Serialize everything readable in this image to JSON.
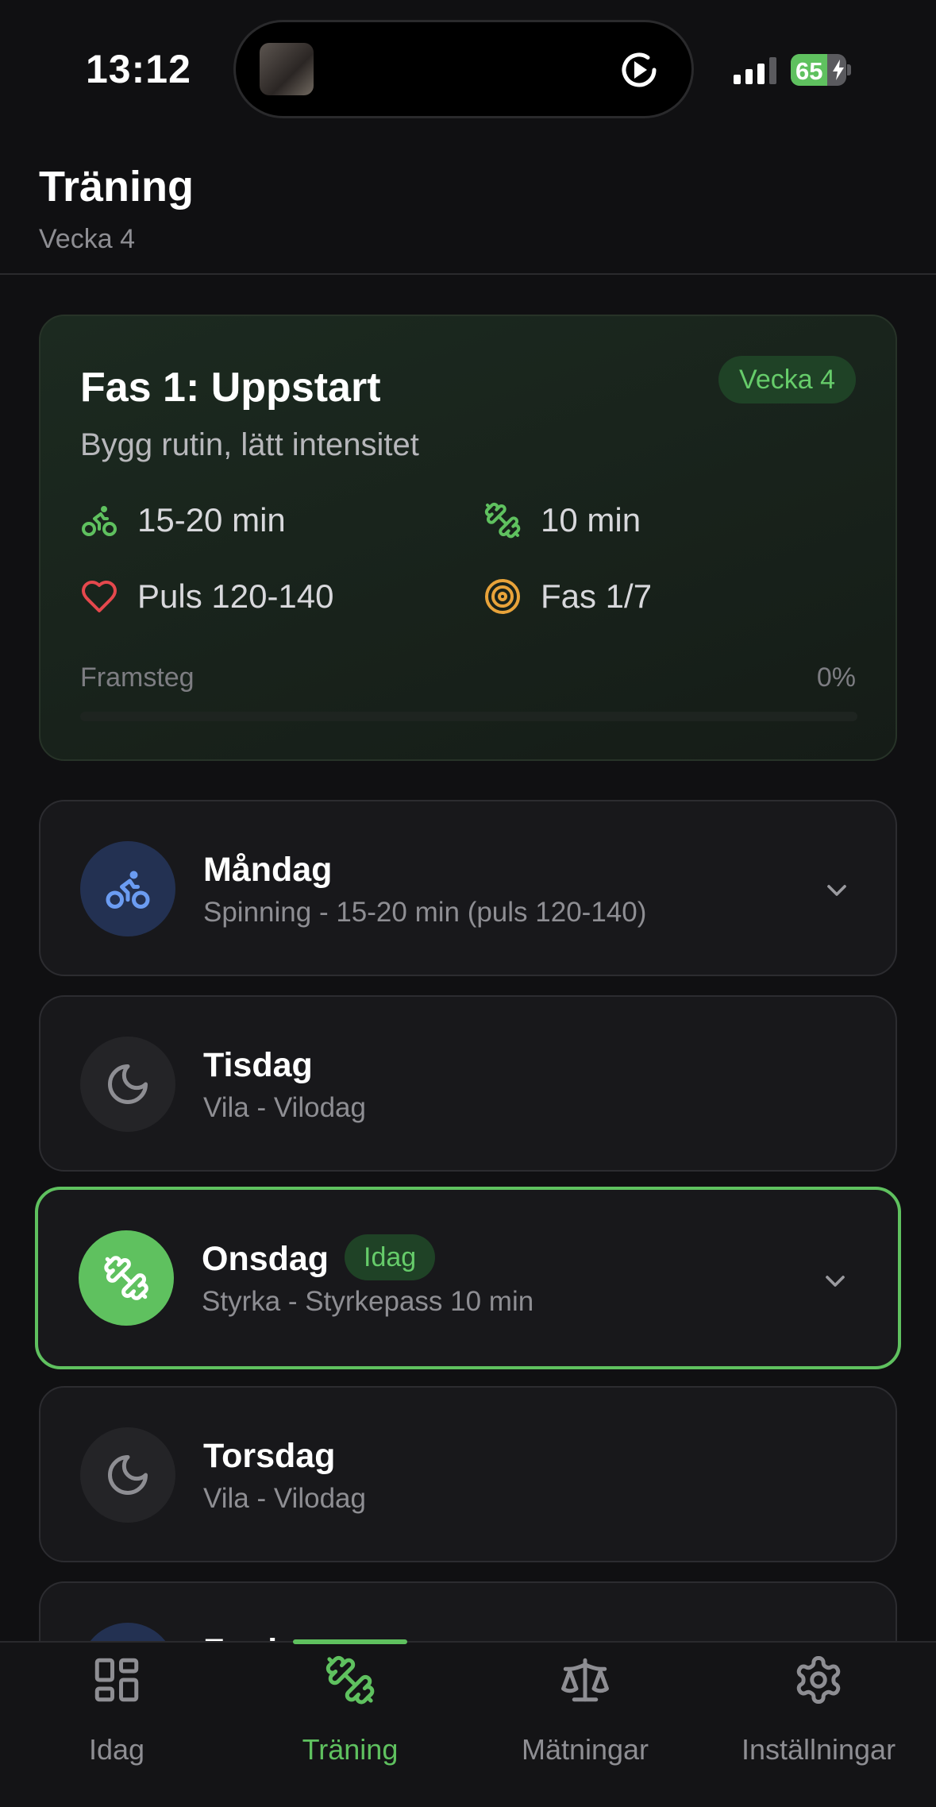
{
  "status_bar": {
    "time": "13:12",
    "battery": "65",
    "battery_level": 0.65
  },
  "header": {
    "title": "Träning",
    "subtitle": "Vecka 4"
  },
  "phase": {
    "title": "Fas 1: Uppstart",
    "badge": "Vecka 4",
    "description": "Bygg rutin, lätt intensitet",
    "stats": [
      {
        "icon": "bike-icon",
        "label": "15-20 min"
      },
      {
        "icon": "dumbbell-icon",
        "label": "10 min"
      },
      {
        "icon": "heart-icon",
        "label": "Puls 120-140"
      },
      {
        "icon": "target-icon",
        "label": "Fas 1/7"
      }
    ],
    "progress_label": "Framsteg",
    "progress_value": "0%",
    "progress": 0
  },
  "days": [
    {
      "name": "Måndag",
      "desc": "Spinning - 15-20 min (puls 120-140)",
      "icon": "bike-icon",
      "expandable": true
    },
    {
      "name": "Tisdag",
      "desc": "Vila - Vilodag",
      "icon": "moon-icon",
      "expandable": false
    },
    {
      "name": "Onsdag",
      "desc": "Styrka - Styrkepass 10 min",
      "icon": "dumbbell-icon",
      "badge": "Idag",
      "today": true,
      "expandable": true
    },
    {
      "name": "Torsdag",
      "desc": "Vila - Vilodag",
      "icon": "moon-icon",
      "expandable": false
    },
    {
      "name": "Fredag",
      "desc": "",
      "icon": "bike-icon"
    }
  ],
  "nav": [
    {
      "label": "Idag",
      "icon": "grid-icon"
    },
    {
      "label": "Träning",
      "icon": "dumbbell-icon",
      "active": true
    },
    {
      "label": "Mätningar",
      "icon": "scale-icon"
    },
    {
      "label": "Inställningar",
      "icon": "gear-icon"
    }
  ],
  "colors": {
    "accent": "#5fc15f",
    "badge_bg": "#1f4226",
    "bike_blue": "#6b9cf2",
    "heart_red": "#e5484d",
    "target_orange": "#e8a33a",
    "background": "#101012",
    "card": "#18181b"
  }
}
